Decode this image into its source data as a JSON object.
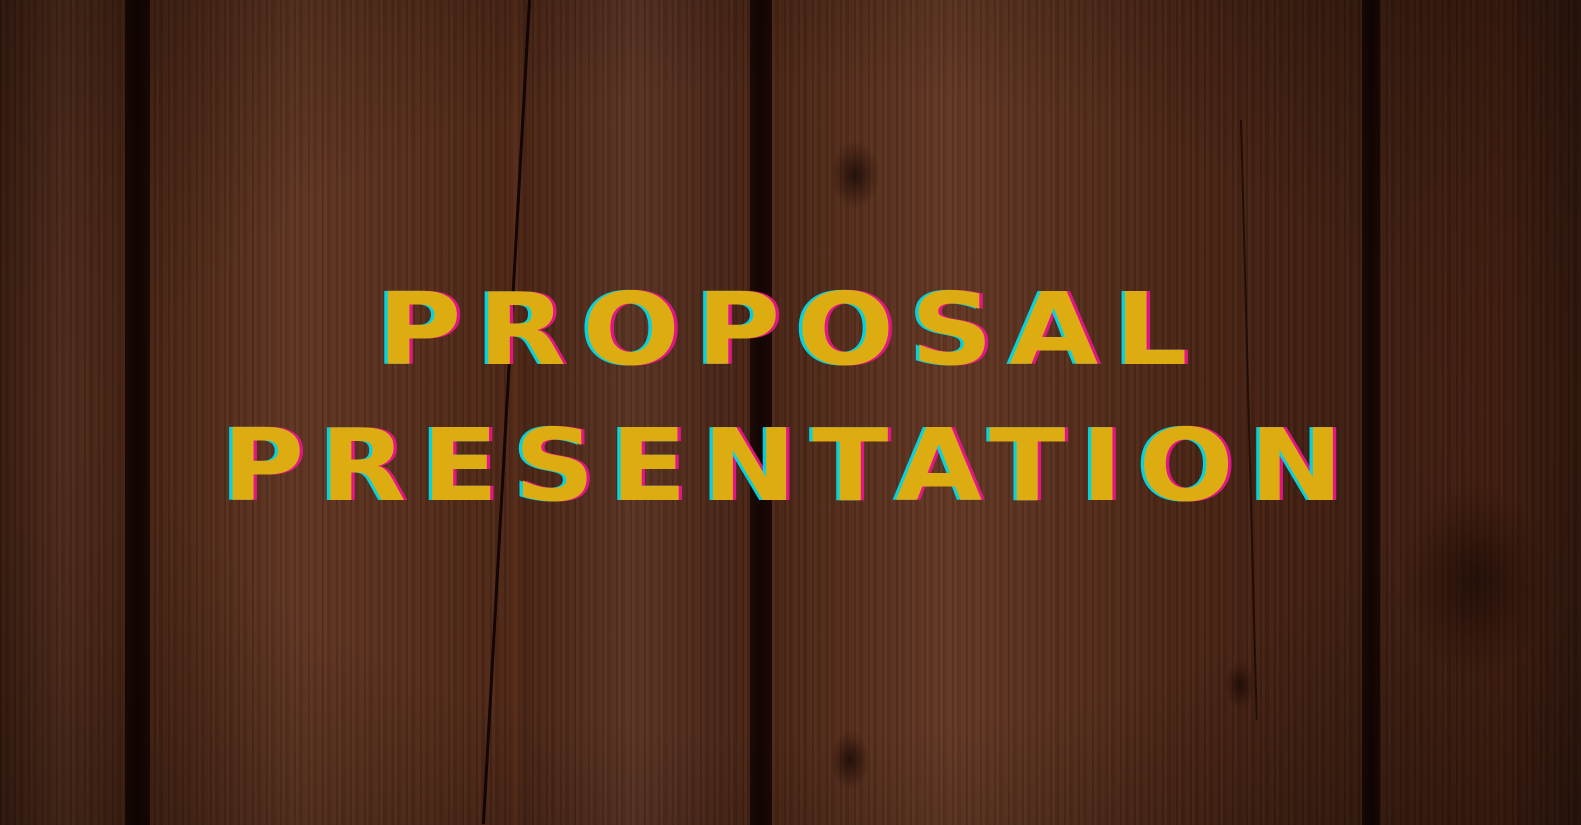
{
  "slide": {
    "title_line_1": "PROPOSAL",
    "title_line_2": "PRESENTATION"
  },
  "colors": {
    "title_fill": "#dcac10",
    "title_shadow_cyan": "#00dceb",
    "title_shadow_magenta": "#eb148c",
    "wood_base": "#4e2616",
    "wood_gap": "#120502"
  },
  "background": {
    "description_icon": "wood-planks-texture"
  }
}
